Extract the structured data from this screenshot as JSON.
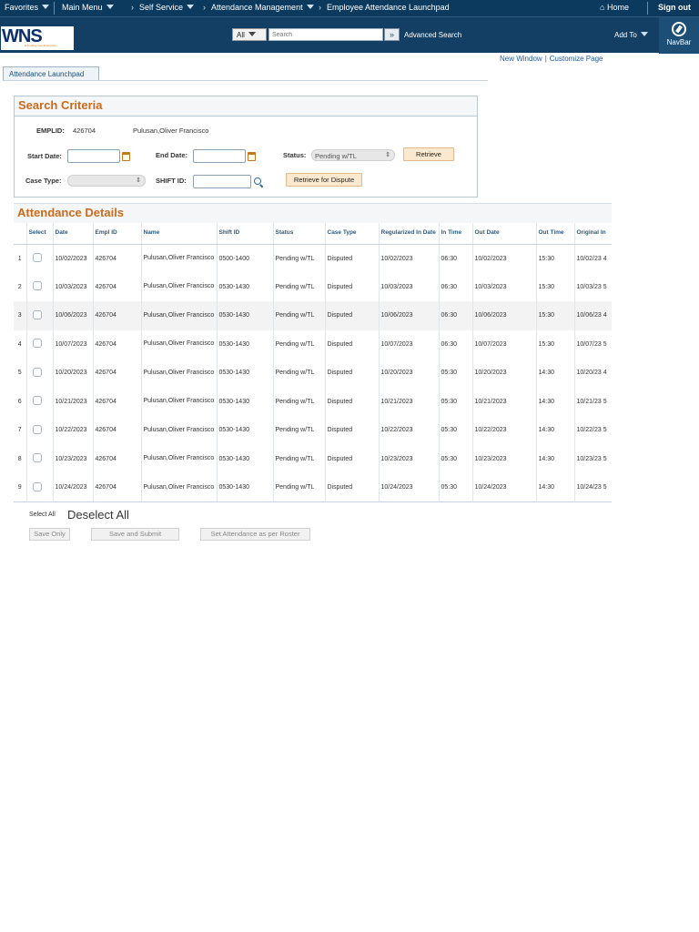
{
  "topbar": {
    "favorites": "Favorites",
    "main_menu": "Main Menu",
    "self_service": "Self Service",
    "attendance_mgmt": "Attendance Management",
    "page": "Employee Attendance Launchpad",
    "home": "Home",
    "sign_out": "Sign out"
  },
  "header": {
    "logo_text": "WNS",
    "logo_tagline": "Extending Your Enterprise",
    "search_category": "All",
    "search_placeholder": "Search",
    "advanced_search": "Advanced Search",
    "add_to": "Add To",
    "navbar": "NavBar"
  },
  "links": {
    "new_window": "New Window",
    "customize_page": "Customize Page"
  },
  "tab": {
    "label": "Attendance Launchpad"
  },
  "criteria": {
    "title": "Search Criteria",
    "emplid_label": "EMPLID:",
    "emplid_value": "426704",
    "employee_name": "Pulusan,Oliver Francisco",
    "start_date_label": "Start Date:",
    "end_date_label": "End Date:",
    "status_label": "Status:",
    "status_value": "Pending w/TL",
    "retrieve": "Retrieve",
    "case_type_label": "Case Type:",
    "shift_id_label": "SHIFT ID:",
    "retrieve_dispute": "Retrieve for Dispute"
  },
  "details": {
    "title": "Attendance Details",
    "columns": [
      "Select",
      "Date",
      "Empl ID",
      "Name",
      "Shift ID",
      "Status",
      "Case Type",
      "Regularized In Date",
      "In Time",
      "Out Date",
      "Out Time",
      "Original In"
    ],
    "rows": [
      {
        "n": "1",
        "date": "10/02/2023",
        "empl": "426704",
        "name": "Pulusan,Oliver Francisco",
        "shift": "0500-1400",
        "status": "Pending w/TL",
        "case": "Disputed",
        "reg": "10/02/2023",
        "in": "06:30",
        "outd": "10/02/2023",
        "out": "15:30",
        "orig": "10/02/23 4"
      },
      {
        "n": "2",
        "date": "10/03/2023",
        "empl": "426704",
        "name": "Pulusan,Oliver Francisco",
        "shift": "0530-1430",
        "status": "Pending w/TL",
        "case": "Disputed",
        "reg": "10/03/2023",
        "in": "06:30",
        "outd": "10/03/2023",
        "out": "15:30",
        "orig": "10/03/23 5"
      },
      {
        "n": "3",
        "date": "10/06/2023",
        "empl": "426704",
        "name": "Pulusan,Oliver Francisco",
        "shift": "0530-1430",
        "status": "Pending w/TL",
        "case": "Disputed",
        "reg": "10/06/2023",
        "in": "06:30",
        "outd": "10/06/2023",
        "out": "15:30",
        "orig": "10/06/23 4"
      },
      {
        "n": "4",
        "date": "10/07/2023",
        "empl": "426704",
        "name": "Pulusan,Oliver Francisco",
        "shift": "0530-1430",
        "status": "Pending w/TL",
        "case": "Disputed",
        "reg": "10/07/2023",
        "in": "06:30",
        "outd": "10/07/2023",
        "out": "15:30",
        "orig": "10/07/23 5"
      },
      {
        "n": "5",
        "date": "10/20/2023",
        "empl": "426704",
        "name": "Pulusan,Oliver Francisco",
        "shift": "0530-1430",
        "status": "Pending w/TL",
        "case": "Disputed",
        "reg": "10/20/2023",
        "in": "05:30",
        "outd": "10/20/2023",
        "out": "14:30",
        "orig": "10/20/23 4"
      },
      {
        "n": "6",
        "date": "10/21/2023",
        "empl": "426704",
        "name": "Pulusan,Oliver Francisco",
        "shift": "0530-1430",
        "status": "Pending w/TL",
        "case": "Disputed",
        "reg": "10/21/2023",
        "in": "05:30",
        "outd": "10/21/2023",
        "out": "14:30",
        "orig": "10/21/23 5"
      },
      {
        "n": "7",
        "date": "10/22/2023",
        "empl": "426704",
        "name": "Pulusan,Oliver Francisco",
        "shift": "0530-1430",
        "status": "Pending w/TL",
        "case": "Disputed",
        "reg": "10/22/2023",
        "in": "05:30",
        "outd": "10/22/2023",
        "out": "14:30",
        "orig": "10/22/23 5"
      },
      {
        "n": "8",
        "date": "10/23/2023",
        "empl": "426704",
        "name": "Pulusan,Oliver Francisco",
        "shift": "0530-1430",
        "status": "Pending w/TL",
        "case": "Disputed",
        "reg": "10/23/2023",
        "in": "05:30",
        "outd": "10/23/2023",
        "out": "14:30",
        "orig": "10/23/23 5"
      },
      {
        "n": "9",
        "date": "10/24/2023",
        "empl": "426704",
        "name": "Pulusan,Oliver Francisco",
        "shift": "0530-1430",
        "status": "Pending w/TL",
        "case": "Disputed",
        "reg": "10/24/2023",
        "in": "05:30",
        "outd": "10/24/2023",
        "out": "14:30",
        "orig": "10/24/23 5"
      }
    ]
  },
  "footer": {
    "select_all": "Select All",
    "deselect_all": "Deselect All",
    "save_only": "Save Only",
    "save_submit": "Save and Submit",
    "set_attendance": "Set Attendance as per Roster"
  },
  "colors": {
    "topbar": "#0b3a5e",
    "header": "#123f63",
    "section_title": "#c96a1c",
    "link": "#1f5a9a"
  }
}
